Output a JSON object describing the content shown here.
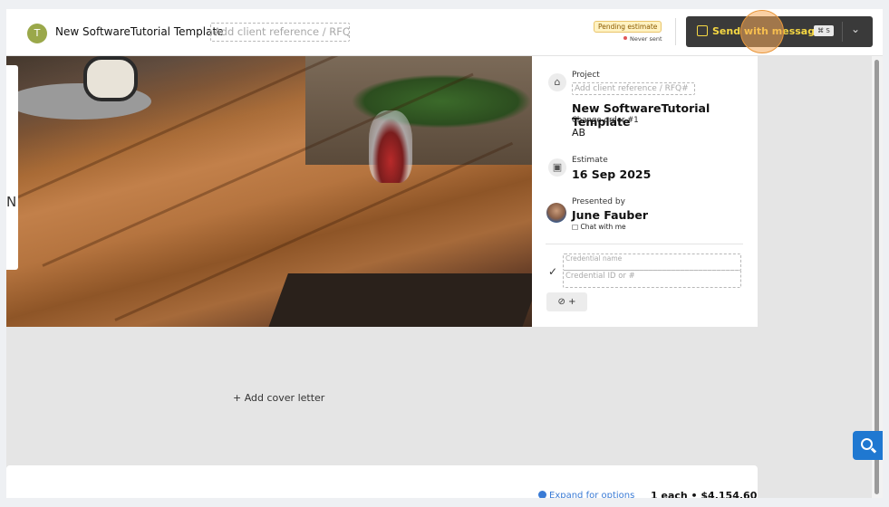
{
  "header": {
    "avatar_initial": "T",
    "title": "New SoftwareTutorial Template",
    "client_ref_placeholder": "Add client reference / RFQ#",
    "status_badge": "Pending estimate",
    "sent_status": "Never sent",
    "send_button_label": "Send with message",
    "send_shortcut": "⌘ S",
    "dropdown_icon": "chevron-down-icon"
  },
  "info": {
    "project_label": "Project",
    "client_ref_placeholder": "Add client reference / RFQ#",
    "project_name": "New SoftwareTutorial Template",
    "change_order": "Change-order #1",
    "initials": "AB",
    "estimate_label": "Estimate",
    "estimate_date": "16 Sep 2025",
    "presented_by_label": "Presented by",
    "presenter_name": "June Fauber",
    "chat_label": "Chat with me",
    "credential_name_placeholder": "Credential name",
    "credential_id_placeholder": "Credential ID or #",
    "add_credential_label": "⊘ +"
  },
  "photo": {
    "side_text": "N"
  },
  "cover_letter": {
    "label": "+  Add cover letter"
  },
  "line_item": {
    "expand_label": "Expand for options",
    "price_summary": "1 each • $4,154.60"
  },
  "colors": {
    "accent_yellow": "#f5d743",
    "send_bg": "#3a3a3a",
    "link_blue": "#3a7bd5",
    "avatar_green": "#9aa84a"
  }
}
